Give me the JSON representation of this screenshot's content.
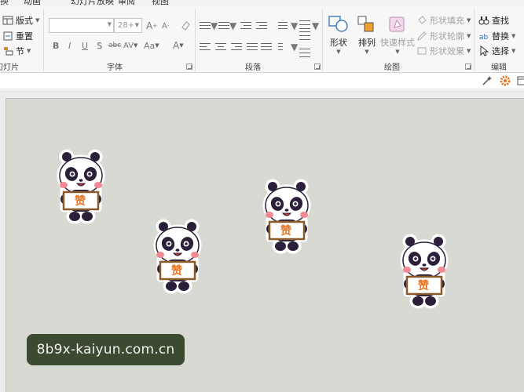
{
  "menu_tabs": [
    "换",
    "动画",
    "幻灯片放映",
    "审阅",
    "视图"
  ],
  "slide_group": {
    "layout_label": "版式",
    "reset_label": "重置",
    "section_label": "节",
    "group_label": "幻灯片"
  },
  "font_group": {
    "font_name_value": "",
    "font_size_value": "28+",
    "grow_label": "A",
    "shrink_label": "A",
    "bold": "B",
    "italic": "I",
    "underline": "U",
    "shadow": "S",
    "strike": "abc",
    "spacing": "AV",
    "case": "Aa",
    "color": "A",
    "group_label": "字体"
  },
  "paragraph_group": {
    "group_label": "段落"
  },
  "drawing_group": {
    "shape_label": "形状",
    "arrange_label": "排列",
    "quick_style_label": "快速样式",
    "fill_label": "形状填充",
    "outline_label": "形状轮廓",
    "effect_label": "形状效果",
    "group_label": "绘图"
  },
  "editing_group": {
    "find_label": "查找",
    "replace_label": "替换",
    "select_label": "选择",
    "group_label": "编辑"
  },
  "pandas": [
    {
      "sign": "赞"
    },
    {
      "sign": "赞"
    },
    {
      "sign": "赞"
    },
    {
      "sign": "赞"
    }
  ],
  "watermark": "8b9x-kaiyun.com.cn",
  "colors": {
    "slide_bg": "#d9d9d4",
    "panda_dark": "#2c1f3a",
    "sign_orange": "#e8731f",
    "watermark_bg": "#3d4a32"
  }
}
